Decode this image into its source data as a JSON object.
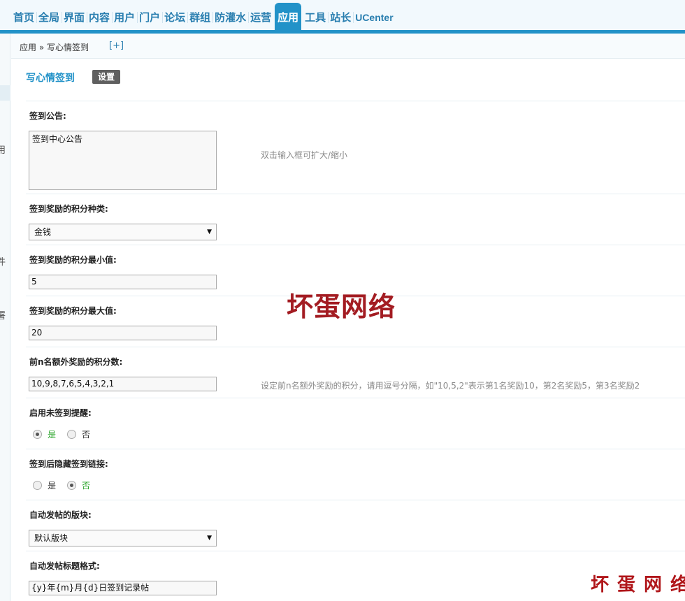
{
  "nav": {
    "items": [
      "首页",
      "全局",
      "界面",
      "内容",
      "用户",
      "门户",
      "论坛",
      "群组",
      "防灌水",
      "运营",
      "应用",
      "工具",
      "站长",
      "UCenter"
    ],
    "active_index": 10
  },
  "sidebar_fragments": [
    "用",
    "件",
    "署"
  ],
  "breadcrumb": {
    "text": "应用 » 写心情签到",
    "add": "[+]"
  },
  "page": {
    "title": "写心情签到",
    "settings_tab": "设置"
  },
  "form": {
    "notice": {
      "label": "签到公告:",
      "value": "签到中心公告",
      "tip": "双击输入框可扩大/缩小"
    },
    "credit_type": {
      "label": "签到奖励的积分种类:",
      "value": "金钱"
    },
    "credit_min": {
      "label": "签到奖励的积分最小值:",
      "value": "5"
    },
    "credit_max": {
      "label": "签到奖励的积分最大值:",
      "value": "20"
    },
    "top_n": {
      "label": "前n名额外奖励的积分数:",
      "value": "10,9,8,7,6,5,4,3,2,1",
      "tip": "设定前n名额外奖励的积分，请用逗号分隔，如\"10,5,2\"表示第1名奖励10，第2名奖励5，第3名奖励2"
    },
    "remind": {
      "label": "启用未签到提醒:",
      "yes": "是",
      "no": "否",
      "selected": "是"
    },
    "hide_link": {
      "label": "签到后隐藏签到链接:",
      "yes": "是",
      "no": "否",
      "selected": "否"
    },
    "forum": {
      "label": "自动发帖的版块:",
      "value": "默认版块"
    },
    "title_format": {
      "label": "自动发帖标题格式:",
      "value": "{y}年{m}月{d}日签到记录帖"
    }
  },
  "watermark": {
    "center": "坏蛋网络",
    "corner": "坏蛋网络"
  }
}
